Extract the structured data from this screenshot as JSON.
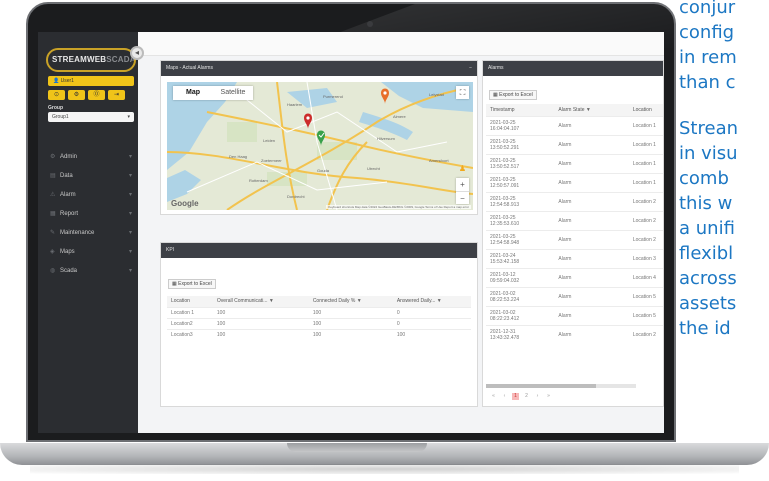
{
  "side_text": {
    "paragraph1": [
      "conjur",
      "config",
      "in rem",
      "than c"
    ],
    "paragraph2": [
      "Strean",
      "in visu",
      "comb",
      "this w",
      "a unifi",
      "flexibl",
      "across",
      "assets",
      "the id"
    ]
  },
  "sidebar": {
    "logo_bold": "STREAMWEB",
    "logo_light": "SCADA",
    "collapse_glyph": "◂",
    "user_label": "User1",
    "actions": [
      "⊙",
      "⚙",
      "⓪",
      "⇥"
    ],
    "group_label": "Group",
    "group_value": "Group1",
    "group_chevron": "▾",
    "menu": [
      {
        "label": "Admin",
        "icon": "⚙",
        "icon_name": "admin-icon"
      },
      {
        "label": "Data",
        "icon": "▤",
        "icon_name": "data-icon"
      },
      {
        "label": "Alarm",
        "icon": "⚠",
        "icon_name": "alarm-icon"
      },
      {
        "label": "Report",
        "icon": "▦",
        "icon_name": "report-icon"
      },
      {
        "label": "Maintenance",
        "icon": "✎",
        "icon_name": "maintenance-icon"
      },
      {
        "label": "Maps",
        "icon": "◈",
        "icon_name": "maps-icon"
      },
      {
        "label": "Scada",
        "icon": "◍",
        "icon_name": "scada-icon"
      }
    ],
    "menu_chevron": "▾"
  },
  "map_panel": {
    "title": "Maps - Actual Alarms",
    "collapse_glyph": "−",
    "tab_map": "Map",
    "tab_satellite": "Satellite",
    "fullscreen_glyph": "⛶",
    "pegman_glyph": "♟",
    "zoom_in": "+",
    "zoom_out": "−",
    "google": "Google",
    "footer": "Keyboard shortcuts   Map data ©2022 GeoBasis-DE/BKG ©2009, Google   Terms of Use   Report a map error",
    "places": [
      "Purmerend",
      "Almere",
      "Hilversum",
      "Utrecht",
      "Amersfoort",
      "Leiden",
      "Zoetermeer",
      "Gouda",
      "Rotterdam",
      "Dordrecht",
      "Lelystad",
      "Haarlem",
      "Den Haag"
    ]
  },
  "kpi_panel": {
    "title": "KPI",
    "export_label": "Export to Excel",
    "columns": [
      "Location",
      "Overall Communicati...",
      "Connected Daily %",
      "Answered Daily..."
    ],
    "rows": [
      [
        "Location 1",
        "100",
        "100",
        "0"
      ],
      [
        "Location2",
        "100",
        "100",
        "0"
      ],
      [
        "Location3",
        "100",
        "100",
        "100"
      ]
    ]
  },
  "alarms_panel": {
    "title": "Alarms",
    "export_label": "Export to Excel",
    "columns": [
      "Timestamp",
      "Alarm State",
      "Location"
    ],
    "rows": [
      [
        "2021-03-25",
        "16:04:04.107",
        "Alarm",
        "Location 1"
      ],
      [
        "2021-03-25",
        "13:50:52.291",
        "Alarm",
        "Location 1"
      ],
      [
        "2021-03-25",
        "13:50:52.517",
        "Alarm",
        "Location 1"
      ],
      [
        "2021-03-25",
        "12:50:57.091",
        "Alarm",
        "Location 1"
      ],
      [
        "2021-03-25",
        "12:54:58.913",
        "Alarm",
        "Location 2"
      ],
      [
        "2021-03-25",
        "12:35:53.610",
        "Alarm",
        "Location 2"
      ],
      [
        "2021-03-25",
        "12:54:58.948",
        "Alarm",
        "Location 2"
      ],
      [
        "2021-03-24",
        "15:53:42.158",
        "Alarm",
        "Location 3"
      ],
      [
        "2021-03-12",
        "09:59:04.032",
        "Alarm",
        "Location 4"
      ],
      [
        "2021-03-02",
        "08:22:53.224",
        "Alarm",
        "Location 5"
      ],
      [
        "2021-03-02",
        "08:22:23.412",
        "Alarm",
        "Location 5"
      ],
      [
        "2021-12-31",
        "13:43:32.478",
        "Alarm",
        "Location 2"
      ]
    ],
    "pager": [
      "«",
      "‹",
      "1",
      "2",
      "›",
      "»"
    ],
    "current_page": "1"
  }
}
